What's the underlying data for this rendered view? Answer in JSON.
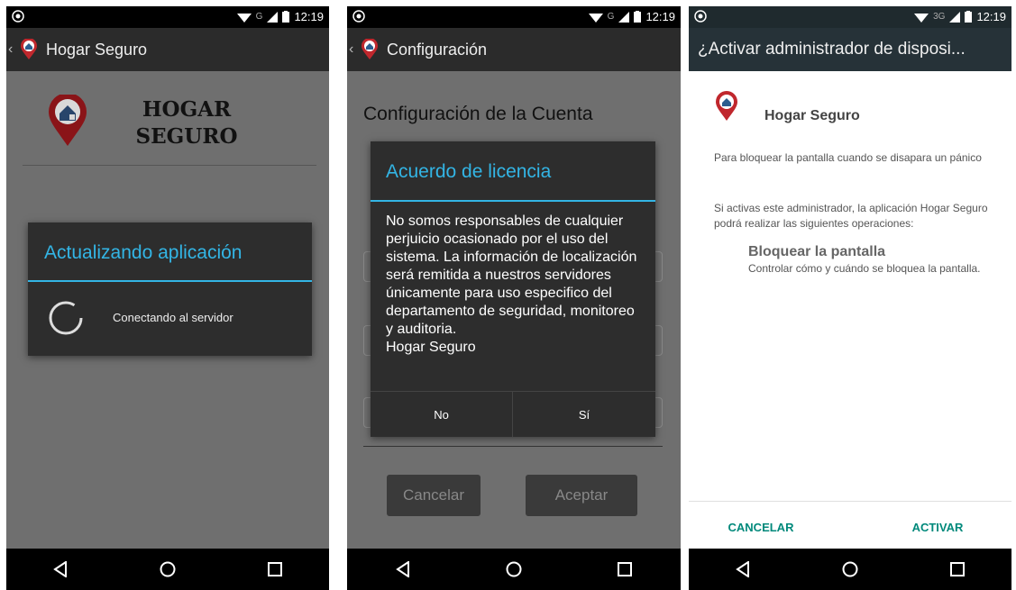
{
  "status": {
    "time": "12:19",
    "network_1": "G",
    "network_2": "G",
    "network_3": "3G"
  },
  "screen1": {
    "appbar_title": "Hogar Seguro",
    "brand_line1": "HOGAR",
    "brand_line2": "SEGURO",
    "dialog_title": "Actualizando aplicación",
    "dialog_message": "Conectando al servidor"
  },
  "screen2": {
    "appbar_title": "Configuración",
    "section_title": "Configuración de la Cuenta",
    "dialog_title": "Acuerdo de licencia",
    "dialog_body": "No somos responsables de cualquier perjuicio ocasionado por el uso del sistema. La información de localización será remitida a nuestros servidores únicamente para uso especifico del departamento de seguridad, monitoreo y auditoria.",
    "dialog_signature": "Hogar Seguro",
    "button_no": "No",
    "button_yes": "Sí",
    "cancel_label": "Cancelar",
    "accept_label": "Aceptar"
  },
  "screen3": {
    "appbar_title": "¿Activar administrador de disposi...",
    "app_name": "Hogar Seguro",
    "purpose_text": "Para bloquear la pantalla cuando se disapara un pánico",
    "info_text": "Si activas este administrador, la aplicación Hogar Seguro podrá realizar las siguientes operaciones:",
    "permission_title": "Bloquear la pantalla",
    "permission_desc": "Controlar cómo y cuándo se bloquea la pantalla.",
    "cancel_label": "CANCELAR",
    "activate_label": "ACTIVAR"
  },
  "colors": {
    "accent": "#33b5e5",
    "teal": "#00897b",
    "appbar": "#2b2b2b",
    "dim": "#6f6f6f",
    "dialog": "#2d2d2d"
  },
  "icons": [
    "pin-house-logo",
    "back-icon",
    "wifi-icon",
    "signal-icon",
    "battery-icon",
    "nav-back-icon",
    "nav-home-icon",
    "nav-recents-icon",
    "spinner-icon"
  ]
}
